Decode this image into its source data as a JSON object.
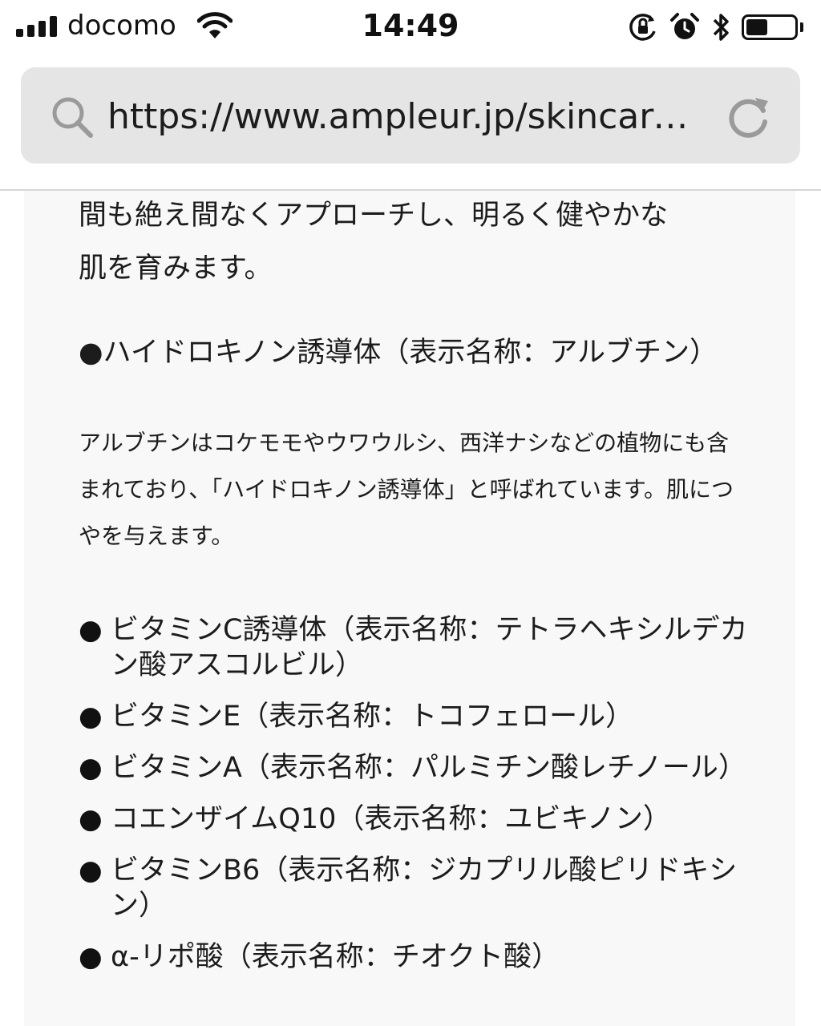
{
  "status_bar": {
    "carrier": "docomo",
    "time": "14:49",
    "signal_bars": 4,
    "battery_level_fraction": 0.45,
    "icons": [
      "signal-icon",
      "wifi-icon",
      "orientation-lock-icon",
      "alarm-icon",
      "bluetooth-icon",
      "battery-icon"
    ]
  },
  "browser": {
    "url": "https://www.ampleur.jp/skincare…",
    "icons": [
      "search-icon",
      "reload-icon"
    ]
  },
  "article": {
    "intro_lines": [
      "間も絶え間なくアプローチし、明るく健やかな",
      "肌を育みます。"
    ],
    "bullet_symbol": "●",
    "feature": {
      "heading": "ハイドロキノン誘導体（表示名称：アルブチン）",
      "description": "アルブチンはコケモモやウワウルシ、西洋ナシなどの植物にも含まれており、「ハイドロキノン誘導体」と呼ばれています。肌につやを与えます。"
    },
    "ingredients": [
      {
        "text": "ビタミンC誘導体（表示名称：テトラヘキシルデカン酸アスコルビル）"
      },
      {
        "text": "ビタミンE（表示名称：トコフェロール）"
      },
      {
        "text": "ビタミンA（表示名称：パルミチン酸レチノール）"
      },
      {
        "text": "コエンザイムQ10（表示名称：ユビキノン）"
      },
      {
        "text": "ビタミンB6（表示名称：ジカプリル酸ピリドキシン）"
      },
      {
        "text": "α-リポ酸（表示名称：チオクト酸）"
      }
    ]
  },
  "colors": {
    "url_bar_bg": "#e5e5e5",
    "content_bg": "#f8f8f8",
    "text": "#1c1c1c",
    "icon_gray": "#9a9a9a"
  }
}
